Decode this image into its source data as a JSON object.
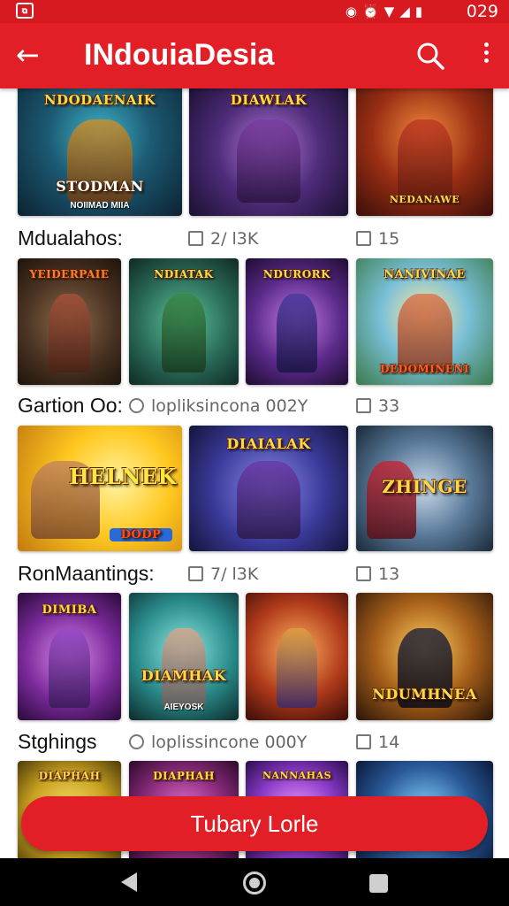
{
  "status_bar": {
    "time": "029",
    "icons": [
      "notification-icon",
      "alarm-icon",
      "wifi-icon",
      "signal-icon",
      "battery-icon"
    ],
    "left_icon": "gallery-icon"
  },
  "app_bar": {
    "title": "INdouiaDesia",
    "back_icon": "back-arrow-icon",
    "search_icon": "search-icon",
    "more_icon": "more-vert-icon"
  },
  "colors": {
    "brand": "#e21e26",
    "status_bar": "#d71920",
    "text": "#111111",
    "meta": "#666666"
  },
  "rows": [
    {
      "label": "",
      "meta_primary": "",
      "meta_secondary": "",
      "tiles": [
        {
          "title": "NDODAENAIK",
          "subtitle": "STODMAN",
          "caption": "NOIIMAD MIIA"
        },
        {
          "title": "DIAWLAK",
          "subtitle": "",
          "caption": ""
        },
        {
          "title": "",
          "subtitle": "",
          "caption": "NEDANAWE"
        }
      ]
    },
    {
      "label": "Mdualahos:",
      "meta_primary": "2/ l3K",
      "meta_secondary": "15",
      "tiles": [
        {
          "title": "YEIDERPAIE",
          "subtitle": "",
          "caption": ""
        },
        {
          "title": "NDIATAK",
          "subtitle": "",
          "caption": ""
        },
        {
          "title": "NDURORK",
          "subtitle": "",
          "caption": ""
        },
        {
          "title": "NANIVINAE",
          "subtitle": "",
          "caption": "DEDOMINENI"
        }
      ]
    },
    {
      "label": "Gartion Oo:",
      "meta_primary": "lopliksincona 002Y",
      "meta_secondary": "33",
      "tiles": [
        {
          "title": "HELNEK",
          "subtitle": "",
          "caption": "DODP"
        },
        {
          "title": "DIAIALAK",
          "subtitle": "",
          "caption": ""
        },
        {
          "title": "ZHINGE",
          "subtitle": "",
          "caption": ""
        }
      ]
    },
    {
      "label": "RonMaantings:",
      "meta_primary": "7/ l3K",
      "meta_secondary": "13",
      "tiles": [
        {
          "title": "DIMIBA",
          "subtitle": "",
          "caption": ""
        },
        {
          "title": "DIAMHAK",
          "subtitle": "",
          "caption": "AIEYOSK"
        },
        {
          "title": "",
          "subtitle": "",
          "caption": ""
        },
        {
          "title": "NDUMHNEA",
          "subtitle": "",
          "caption": ""
        }
      ]
    },
    {
      "label": "Stghings",
      "meta_primary": "loplissincone 000Y",
      "meta_secondary": "14",
      "tiles": [
        {
          "title": "DIAPHAH",
          "subtitle": "",
          "caption": ""
        },
        {
          "title": "DIAPHAH",
          "subtitle": "",
          "caption": ""
        },
        {
          "title": "NANNAHAS",
          "subtitle": "",
          "caption": ""
        },
        {
          "title": "",
          "subtitle": "",
          "caption": ""
        }
      ]
    }
  ],
  "cta": {
    "label": "Tubary Lorle"
  },
  "nav_bar": {
    "icons": [
      "nav-back-icon",
      "nav-home-icon",
      "nav-recents-icon"
    ]
  }
}
